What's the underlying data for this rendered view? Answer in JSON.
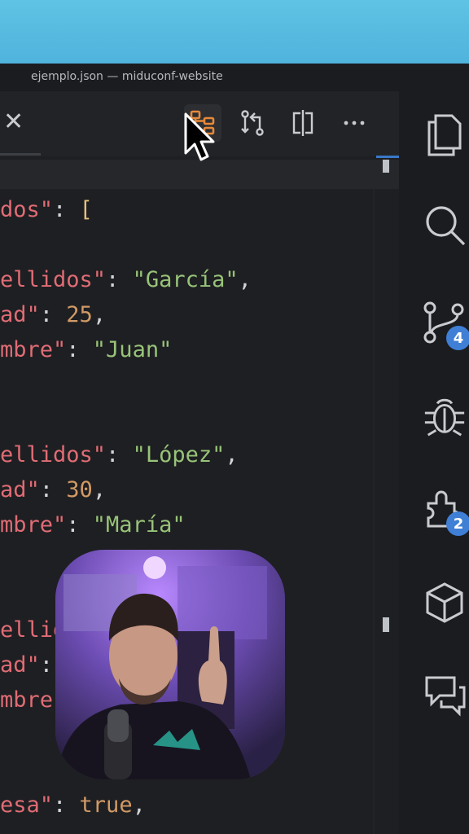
{
  "window": {
    "title": "ejemplo.json — miduconf-website"
  },
  "tab": {
    "close_glyph": "✕"
  },
  "toolbar": {
    "actions": [
      {
        "icon": "json-tree-view-icon",
        "active": true
      },
      {
        "icon": "compare-changes-icon"
      },
      {
        "icon": "split-editor-icon"
      },
      {
        "icon": "more-actions-icon"
      }
    ]
  },
  "code_lines": [
    [
      {
        "t": "k",
        "v": "dos\""
      },
      {
        "t": "p",
        "v": ": "
      },
      {
        "t": "b",
        "v": "["
      }
    ],
    [],
    [
      {
        "t": "k",
        "v": "ellidos\""
      },
      {
        "t": "p",
        "v": ": "
      },
      {
        "t": "s",
        "v": "\"García\""
      },
      {
        "t": "p",
        "v": ","
      }
    ],
    [
      {
        "t": "k",
        "v": "ad\""
      },
      {
        "t": "p",
        "v": ": "
      },
      {
        "t": "n",
        "v": "25"
      },
      {
        "t": "p",
        "v": ","
      }
    ],
    [
      {
        "t": "k",
        "v": "mbre\""
      },
      {
        "t": "p",
        "v": ": "
      },
      {
        "t": "s",
        "v": "\"Juan\""
      }
    ],
    [],
    [],
    [
      {
        "t": "k",
        "v": "ellidos\""
      },
      {
        "t": "p",
        "v": ": "
      },
      {
        "t": "s",
        "v": "\"López\""
      },
      {
        "t": "p",
        "v": ","
      }
    ],
    [
      {
        "t": "k",
        "v": "ad\""
      },
      {
        "t": "p",
        "v": ": "
      },
      {
        "t": "n",
        "v": "30"
      },
      {
        "t": "p",
        "v": ","
      }
    ],
    [
      {
        "t": "k",
        "v": "mbre\""
      },
      {
        "t": "p",
        "v": ": "
      },
      {
        "t": "s",
        "v": "\"María\""
      }
    ],
    [],
    [],
    [
      {
        "t": "k",
        "v": "ellid"
      }
    ],
    [
      {
        "t": "k",
        "v": "ad\""
      },
      {
        "t": "p",
        "v": ":"
      }
    ],
    [
      {
        "t": "k",
        "v": "mbre"
      }
    ],
    [],
    [],
    [
      {
        "t": "k",
        "v": "esa\""
      },
      {
        "t": "p",
        "v": ": "
      },
      {
        "t": "n",
        "v": "true"
      },
      {
        "t": "p",
        "v": ","
      }
    ]
  ],
  "activity_bar": [
    {
      "icon": "explorer-files-icon"
    },
    {
      "icon": "search-icon"
    },
    {
      "icon": "source-control-icon",
      "badge": "4"
    },
    {
      "icon": "run-debug-icon"
    },
    {
      "icon": "extensions-icon",
      "badge": "2"
    },
    {
      "icon": "remote-explorer-icon"
    },
    {
      "icon": "chat-icon"
    }
  ],
  "colors": {
    "accent": "#3f7fd6",
    "keyword": "#e06c75",
    "string": "#98c379",
    "number": "#d19a66",
    "active_icon": "#e7893a"
  }
}
